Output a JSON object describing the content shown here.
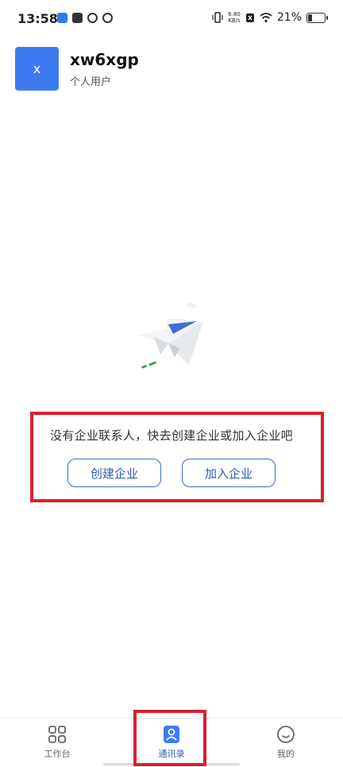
{
  "status_bar": {
    "time": "13:58",
    "net_speed_value": "6.80",
    "net_speed_unit": "KB/s",
    "battery": "21%"
  },
  "user": {
    "avatar_letter": "x",
    "name": "xw6xgp",
    "type": "个人用户"
  },
  "empty_state": {
    "message": "没有企业联系人，快去创建企业或加入企业吧",
    "create_label": "创建企业",
    "join_label": "加入企业"
  },
  "nav": {
    "items": [
      {
        "label": "工作台",
        "icon": "grid-icon",
        "active": false
      },
      {
        "label": "通讯录",
        "icon": "contacts-icon",
        "active": true
      },
      {
        "label": "我的",
        "icon": "smiley-icon",
        "active": false
      }
    ]
  },
  "colors": {
    "accent": "#2a5fb5",
    "avatar_bg": "#3e7bf0",
    "annotation": "#dc1f2d"
  }
}
